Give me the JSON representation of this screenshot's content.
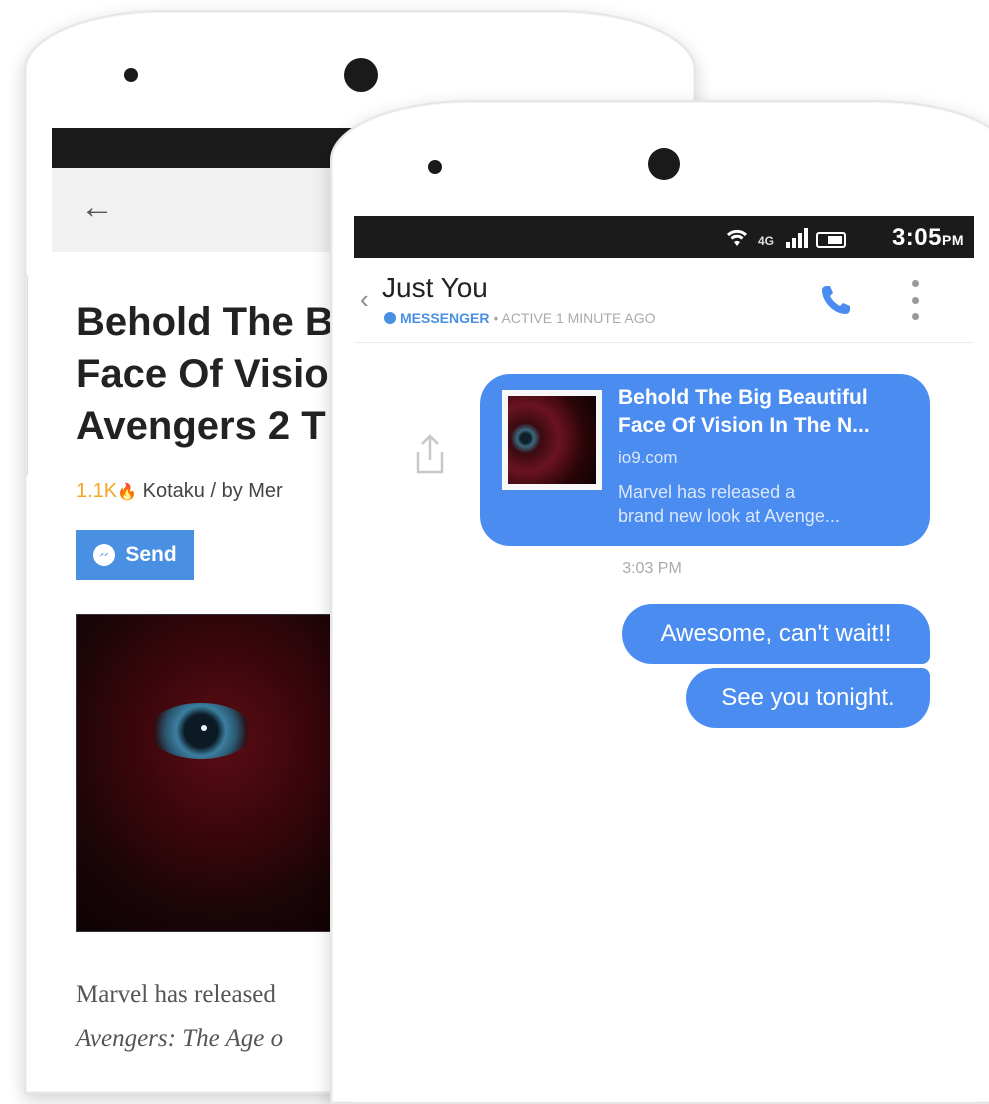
{
  "back_phone": {
    "article": {
      "title_lines": [
        "Behold The B",
        "Face Of Visio",
        "Avengers 2 T"
      ],
      "count": "1.1K",
      "source": "Kotaku / by Mer",
      "send_label": "Send",
      "body_line1": "Marvel has released",
      "body_line2": "Avengers: The Age o"
    }
  },
  "front_phone": {
    "status": {
      "network": "4G",
      "time": "3:05",
      "ampm": "PM"
    },
    "chat": {
      "title": "Just You",
      "app": "MESSENGER",
      "active": "• ACTIVE 1 MINUTE AGO"
    },
    "link_card": {
      "title_line1": "Behold The Big Beautiful",
      "title_line2": "Face Of Vision In The N...",
      "domain": "io9.com",
      "desc_line1": "Marvel has released a",
      "desc_line2": "brand new look at Avenge..."
    },
    "timestamp": "3:03 PM",
    "messages": [
      {
        "text": "Awesome, can't wait!!"
      },
      {
        "text": "See you tonight."
      }
    ]
  },
  "colors": {
    "messenger_blue": "#4a8cf0",
    "send_blue": "#4a90e2",
    "count_orange": "#f5a623"
  },
  "icons": [
    "back-arrow-icon",
    "flame-icon",
    "messenger-icon",
    "wifi-icon",
    "signal-icon",
    "battery-icon",
    "chevron-left-icon",
    "phone-icon",
    "more-vert-icon",
    "share-icon"
  ]
}
